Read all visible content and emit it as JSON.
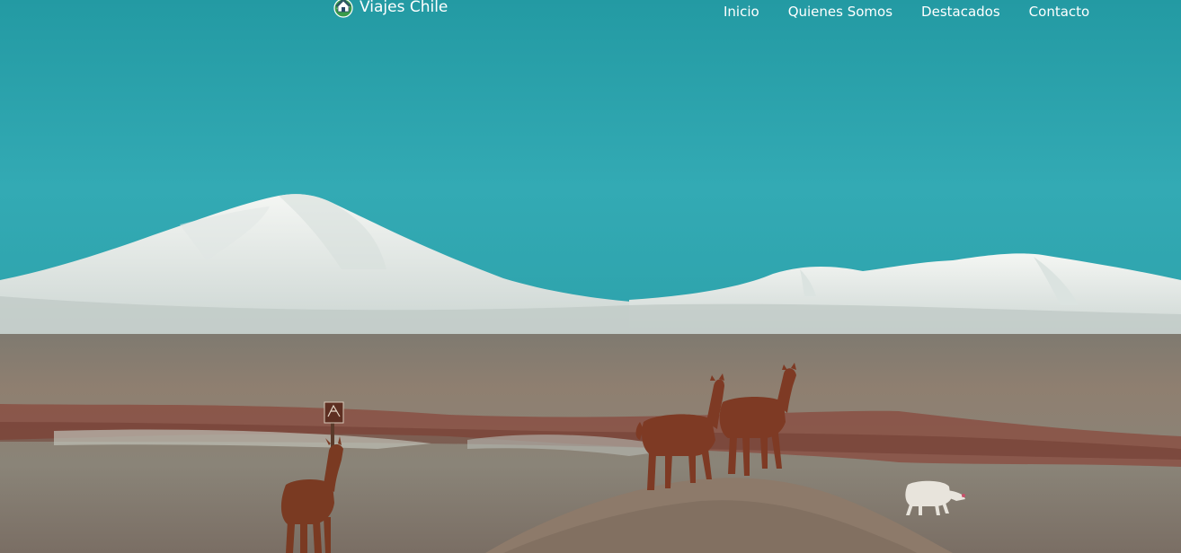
{
  "brand": {
    "name": "Viajes Chile",
    "logo_icon": "house-globe-logo-icon"
  },
  "nav": {
    "items": [
      {
        "label": "Inicio"
      },
      {
        "label": "Quienes Somos"
      },
      {
        "label": "Destacados"
      },
      {
        "label": "Contacto"
      }
    ]
  },
  "hero": {
    "image_subject": "atacama-altiplano-llamas-volcano",
    "colors": {
      "sky": "#2fa6b0",
      "snow": "#eef2f0",
      "ground": "#8a7a6c",
      "llama": "#7a3a20"
    }
  }
}
